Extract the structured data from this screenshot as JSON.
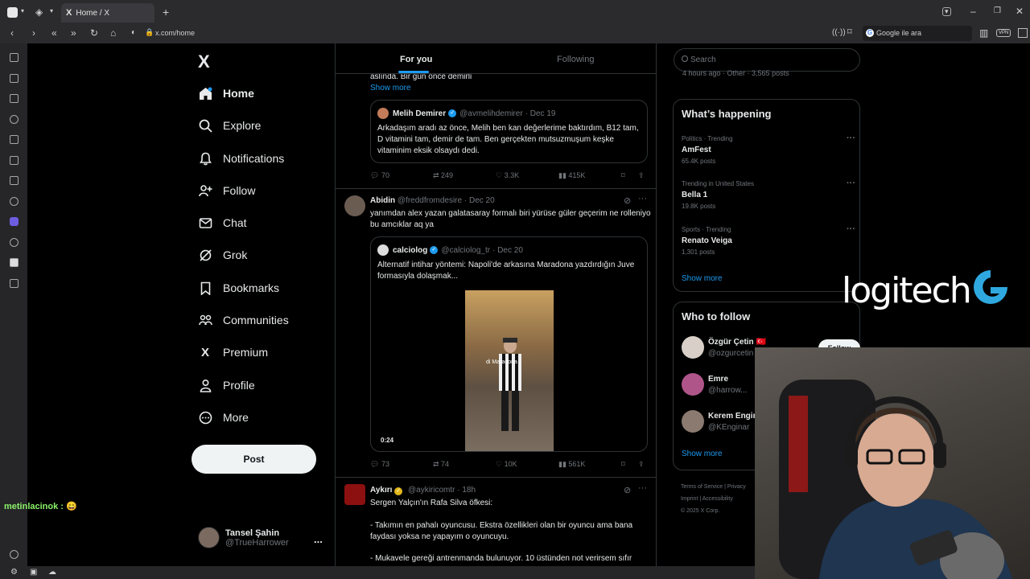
{
  "browser": {
    "tab_title": "Home / X",
    "tab_logo": "X",
    "url": "x.com/home",
    "search_engine_placeholder": "Google ile ara",
    "vpn_label": "VPN"
  },
  "nav": {
    "logo": "X",
    "items": [
      {
        "label": "Home",
        "icon": "home-icon"
      },
      {
        "label": "Explore",
        "icon": "search-icon"
      },
      {
        "label": "Notifications",
        "icon": "bell-icon"
      },
      {
        "label": "Follow",
        "icon": "person-add-icon"
      },
      {
        "label": "Chat",
        "icon": "mail-icon"
      },
      {
        "label": "Grok",
        "icon": "grok-icon"
      },
      {
        "label": "Bookmarks",
        "icon": "bookmark-icon"
      },
      {
        "label": "Communities",
        "icon": "people-icon"
      },
      {
        "label": "Premium",
        "icon": "x-icon"
      },
      {
        "label": "Profile",
        "icon": "user-icon"
      },
      {
        "label": "More",
        "icon": "more-circle-icon"
      }
    ],
    "post_label": "Post",
    "account": {
      "name": "Tansel Şahin",
      "handle": "@TrueHarrower",
      "more": "..."
    }
  },
  "chat_overlay": "metinlacinok : 😄",
  "timeline": {
    "tabs": [
      "For you",
      "Following"
    ],
    "fragment_text": "aslında. Bir gün önce demirli",
    "show_more": "Show more",
    "quote1": {
      "name": "Melih Demirer",
      "handle": "@avmelihdemirer",
      "date": "· Dec 19",
      "text": "Arkadaşım aradı az önce, Melih ben kan değerlerime baktırdım, B12 tam, D vitamini tam, demir de tam. Ben gerçekten mutsuzmuşum keşke vitaminim eksik olsaydı dedi."
    },
    "actions1": {
      "replies": "70",
      "reposts": "249",
      "likes": "3.3K",
      "views": "415K"
    },
    "tweet2": {
      "name": "Abidin",
      "handle": "@freddfromdesire",
      "date": "· Dec 20",
      "text": "yanımdan alex yazan galatasaray formalı biri yürüse güler geçerim ne rolleniyo bu amcıklar aq ya"
    },
    "quote2": {
      "name": "calciolog",
      "handle": "@calciolog_tr",
      "date": "· Dec 20",
      "text": "Alternatif intihar yöntemi: Napoli'de arkasına Maradona yazdırdığın Juve formasıyla dolaşmak...",
      "media_caption": "di Maradona",
      "media_time": "0:24"
    },
    "actions2": {
      "replies": "73",
      "reposts": "74",
      "likes": "10K",
      "views": "561K"
    },
    "tweet3": {
      "name": "Aykırı",
      "handle": "@aykiricomtr",
      "date": "· 18h",
      "line1": "Sergen Yalçın'ın Rafa Silva öfkesi:",
      "line2": "- Takımın en pahalı oyuncusu. Ekstra özellikleri olan bir oyuncu ama bana faydası yoksa ne yapayım o oyuncuyu.",
      "line3": "- Mukavele gereği antrenmanda bulunuyor. 10 üstünden not verirsem sıfır"
    }
  },
  "sidebar": {
    "search_placeholder": "Search",
    "peek_text": "4 hours ago · Other · 3,565 posts",
    "happening": {
      "title": "What’s happening",
      "trends": [
        {
          "category": "Politics · Trending",
          "name": "AmFest",
          "count": "65.4K posts"
        },
        {
          "category": "Trending in United States",
          "name": "Bella 1",
          "count": "19.8K posts"
        },
        {
          "category": "Sports · Trending",
          "name": "Renato Veiga",
          "count": "1,301 posts"
        }
      ],
      "show_more": "Show more"
    },
    "who_to_follow": {
      "title": "Who to follow",
      "users": [
        {
          "name": "Özgür Çetin 🇹🇷",
          "handle": "@ozgurcetin"
        },
        {
          "name": "Emre",
          "handle": "@harrow..."
        },
        {
          "name": "Kerem Engin",
          "handle": "@KEnginar"
        }
      ],
      "follow_label": "Follow",
      "show_more": "Show more"
    },
    "footer": [
      "Terms of Service",
      "Privacy",
      "Imprint",
      "Accessibility",
      "© 2025 X Corp."
    ]
  },
  "overlay_logo": "logitech"
}
